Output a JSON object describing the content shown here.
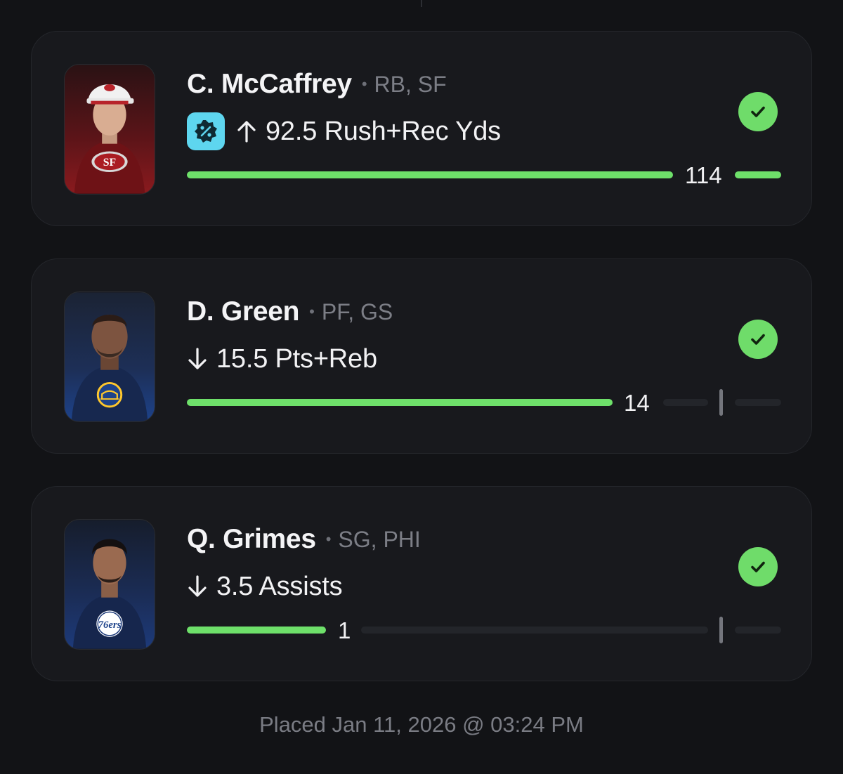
{
  "picks": [
    {
      "name": "C. McCaffrey",
      "position": "RB, SF",
      "line": "92.5 Rush+Rec Yds",
      "direction": "over",
      "has_boost": true,
      "boost_icon": "percent-badge-icon",
      "result": "114",
      "status": "won",
      "team_colors": {
        "primary": "#8a1a1e",
        "secondary": "#b3995d"
      }
    },
    {
      "name": "D. Green",
      "position": "PF, GS",
      "line": "15.5 Pts+Reb",
      "direction": "under",
      "has_boost": false,
      "result": "14",
      "status": "won",
      "team_colors": {
        "primary": "#1d428a",
        "secondary": "#ffc72c"
      }
    },
    {
      "name": "Q. Grimes",
      "position": "SG, PHI",
      "line": "3.5 Assists",
      "direction": "under",
      "has_boost": false,
      "result": "1",
      "status": "won",
      "team_colors": {
        "primary": "#1d3a7a",
        "secondary": "#ed174c"
      }
    }
  ],
  "footer": {
    "placed_text": "Placed Jan 11, 2026 @ 03:24 PM"
  },
  "colors": {
    "background": "#121316",
    "card": "#18191d",
    "success": "#6fdc6a",
    "progress": "#6ee06a",
    "boost": "#5ed6ef"
  }
}
